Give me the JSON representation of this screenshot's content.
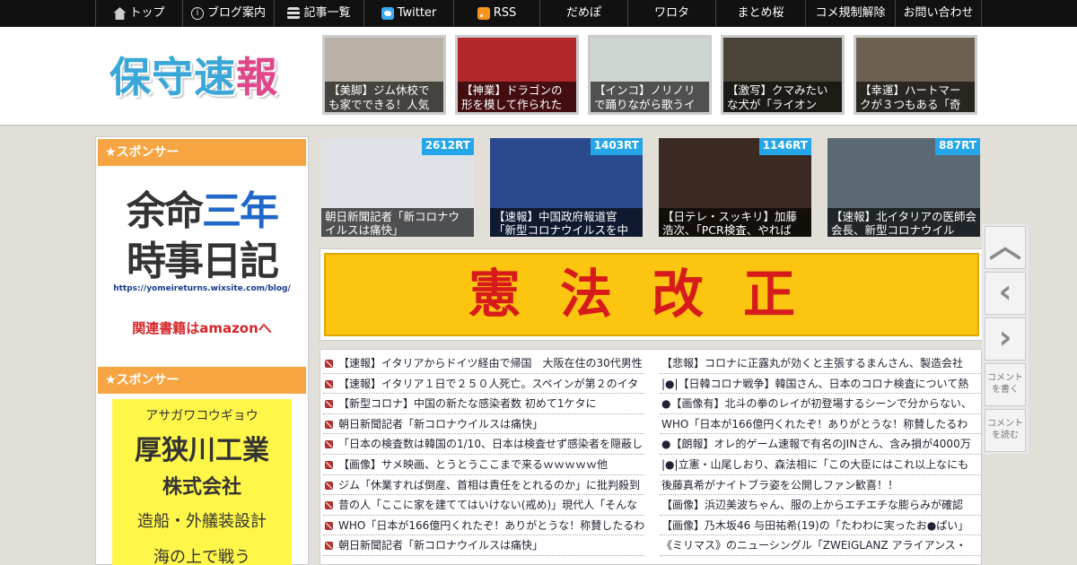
{
  "nav": {
    "items": [
      {
        "label": "トップ",
        "icon": "home-icon"
      },
      {
        "label": "ブログ案内",
        "icon": "info-icon"
      },
      {
        "label": "記事一覧",
        "icon": "list-icon"
      },
      {
        "label": "Twitter",
        "icon": "twitter-icon"
      },
      {
        "label": "RSS",
        "icon": "rss-icon"
      },
      {
        "label": "だめぽ"
      },
      {
        "label": "ワロタ"
      },
      {
        "label": "まとめ桜"
      },
      {
        "label": "コメ規制解除"
      },
      {
        "label": "お問い合わせ"
      }
    ]
  },
  "header": {
    "logo_main": "保守速",
    "logo_accent": "報",
    "thumbs": [
      {
        "caption": "【美脚】ジム休校でも家でできる！人気",
        "color": "#b9b1a6"
      },
      {
        "caption": "【神業】ドラゴンの形を模して作られた",
        "color": "#b3262a"
      },
      {
        "caption": "【インコ】ノリノリで踊りながら歌うイ",
        "color": "#cfd6cf"
      },
      {
        "caption": "【激写】クマみたいな犬が「ライオン",
        "color": "#4a4438"
      },
      {
        "caption": "【幸運】ハートマークが３つもある「奇",
        "color": "#6d6154"
      }
    ]
  },
  "sidebar": {
    "sponsor_label": "★スポンサー",
    "ad1": {
      "line1a": "余命",
      "line1b": "三年",
      "line2": "時事日記",
      "url": "https://yomeireturns.wixsite.com/blog/",
      "amazon": "関連書籍はamazonへ"
    },
    "ad2": {
      "kana": "アサガワコウギョウ",
      "name": "厚狭川工業",
      "kk": "株式会社",
      "biz": "造船・外艤装設計",
      "more": "海の上で戦う"
    }
  },
  "rt_cards": [
    {
      "count": "2612RT",
      "caption": "朝日新聞記者「新コロナウイルスは痛快」",
      "color": "#dfe3e8"
    },
    {
      "count": "1403RT",
      "caption": "【速報】中国政府報道官「新型コロナウイルスを中",
      "color": "#2b4a8e"
    },
    {
      "count": "1146RT",
      "caption": "【日テレ・スッキリ】加藤浩次、「PCR検査、やれば",
      "color": "#3a2a22"
    },
    {
      "count": "887RT",
      "caption": "【速報】北イタリアの医師会会長、新型コロナウイル",
      "color": "#5b6a72"
    }
  ],
  "banner": {
    "text": "憲法改正"
  },
  "news_left": [
    "【速報】イタリアからドイツ経由で帰国　大阪在住の30代男性",
    "【速報】イタリア１日で２５０人死亡。スペインが第２のイタ",
    "【新型コロナ】中国の新たな感染者数 初めて1ケタに",
    "朝日新聞記者「新コロナウイルスは痛快」",
    "「日本の検査数は韓国の1/10、日本は検査せず感染者を隠蔽し",
    "【画像】サメ映画、とうとうここまで来るｗｗｗｗｗ他",
    "ジム「休業すれば倒産、首相は責任をとれるのか」に批判殺到",
    "昔の人「ここに家を建ててはいけない(戒め)」現代人「そんな",
    "WHO「日本が166億円くれたぞ！ありがとうな！称賛したるわ",
    "朝日新聞記者「新コロナウイルスは痛快」"
  ],
  "news_right": [
    "【悲報】コロナに正露丸が効くと主張するまんさん、製造会社",
    "|●|【日韓コロナ戦争】韓国さん、日本のコロナ検査について熱",
    "●【画像有】北斗の拳のレイが初登場するシーンで分からない、",
    "WHO「日本が166億円くれたぞ！ありがとうな！称賛したるわ",
    "●【朗報】オレ的ゲーム速報で有名のJINさん、含み損が4000万",
    "|●|立憲・山尾しおり、森法相に「この大臣にはこれ以上なにも",
    "後藤真希がナイトブラ姿を公開しファン歓喜！！",
    "【画像】浜辺美波ちゃん、服の上からエチエチな膨らみが確認",
    "【画像】乃木坂46 与田祐希(19)の「たわわに実ったお●ぱい」",
    "《ミリマス》のニューシングル「ZWEIGLANZ アライアンス・"
  ],
  "side_buttons": {
    "up": "page-up",
    "prev": "previous",
    "next": "next",
    "comment_write": "コメントを書く",
    "comment_read": "コメントを読む"
  }
}
